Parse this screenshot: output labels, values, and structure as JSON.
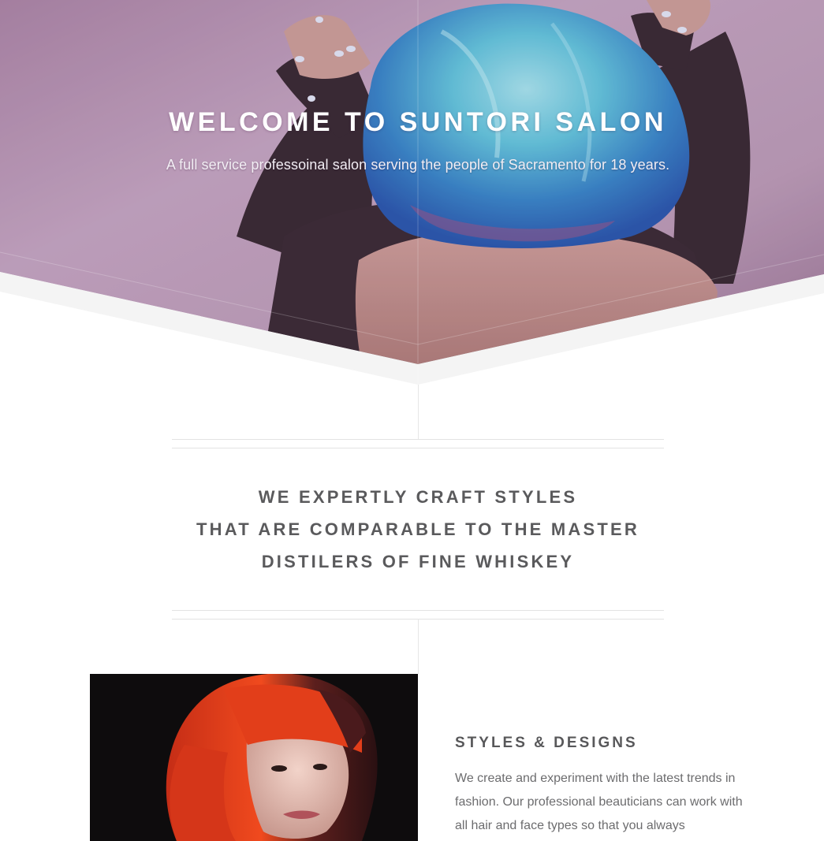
{
  "hero": {
    "title": "WELCOME TO SUNTORI SALON",
    "subtitle": "A full service professoinal salon serving the people of Sacramento for 18 years.",
    "image": "woman-with-blue-dyed-hair-photo"
  },
  "tagline": {
    "lines": [
      "WE EXPERTLY CRAFT STYLES",
      "THAT ARE COMPARABLE TO THE MASTER",
      "DISTILERS OF FINE WHISKEY"
    ]
  },
  "feature": {
    "image": "woman-with-red-bob-haircut-photo",
    "heading": "STYLES & DESIGNS",
    "body": "We create and experiment with the latest trends in fashion. Our professional beauticians can work with all hair and face types so that you always"
  },
  "colors": {
    "hero_tint": "#b697b3",
    "heading_text": "#5a5a5c",
    "body_text": "#6c6c6e",
    "divider": "#e3e3e3",
    "hair_blue": "#4fb8d6"
  }
}
